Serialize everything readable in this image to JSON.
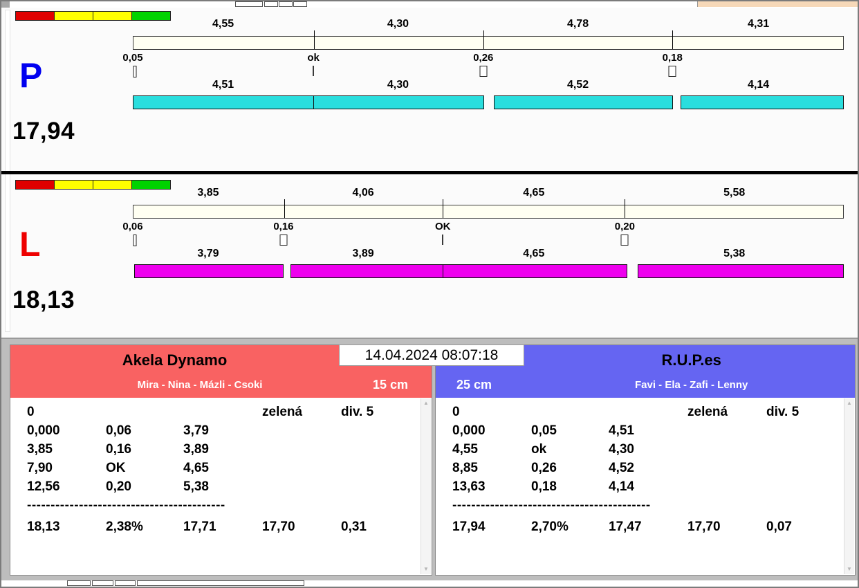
{
  "datetime": "14.04.2024 08:07:18",
  "lanes": [
    {
      "letter": "P",
      "total": "17,94",
      "upper_values": [
        "4,55",
        "4,30",
        "4,78",
        "4,31"
      ],
      "splits": [
        "0,05",
        "ok",
        "0,26",
        "0,18"
      ],
      "lower_values": [
        "4,51",
        "4,30",
        "4,52",
        "4,14"
      ]
    },
    {
      "letter": "L",
      "total": "18,13",
      "upper_values": [
        "3,85",
        "4,06",
        "4,65",
        "5,58"
      ],
      "splits": [
        "0,06",
        "0,16",
        "OK",
        "0,20"
      ],
      "lower_values": [
        "3,79",
        "3,89",
        "4,65",
        "5,38"
      ]
    }
  ],
  "teams": [
    {
      "name": "Akela Dynamo",
      "members": "Mira - Nina - Mázli - Csoki",
      "size_class": "15 cm",
      "rows": [
        [
          "0",
          "",
          "",
          "zelená",
          "div. 5"
        ],
        [
          "0,000",
          "0,06",
          "3,79",
          "",
          ""
        ],
        [
          "3,85",
          "0,16",
          "3,89",
          "",
          ""
        ],
        [
          "7,90",
          "OK",
          "4,65",
          "",
          ""
        ],
        [
          "12,56",
          "0,20",
          "5,38",
          "",
          ""
        ]
      ],
      "separator": "------------------------------------------",
      "summary": [
        "18,13",
        "2,38%",
        "17,71",
        "17,70",
        "0,31"
      ]
    },
    {
      "name": "R.U.P.es",
      "members": "Favi - Ela - Zafi - Lenny",
      "size_class": "25 cm",
      "rows": [
        [
          "0",
          "",
          "",
          "zelená",
          "div. 5"
        ],
        [
          "0,000",
          "0,05",
          "4,51",
          "",
          ""
        ],
        [
          "4,55",
          "ok",
          "4,30",
          "",
          ""
        ],
        [
          "8,85",
          "0,26",
          "4,52",
          "",
          ""
        ],
        [
          "13,63",
          "0,18",
          "4,14",
          "",
          ""
        ]
      ],
      "separator": "------------------------------------------",
      "summary": [
        "17,94",
        "2,70%",
        "17,47",
        "17,70",
        "0,07"
      ]
    }
  ],
  "colors": {
    "lane_p_letter": "#0000f0",
    "lane_l_letter": "#ee0000",
    "scale_bar": "#fffff2",
    "p_result_bar": "#2adede",
    "l_result_bar": "#ee00ee",
    "team_left_header": "#f96262",
    "team_right_header": "#6565f2",
    "indicator_colors": [
      "#e00000",
      "#ffff00",
      "#ffff00",
      "#00d300"
    ]
  }
}
